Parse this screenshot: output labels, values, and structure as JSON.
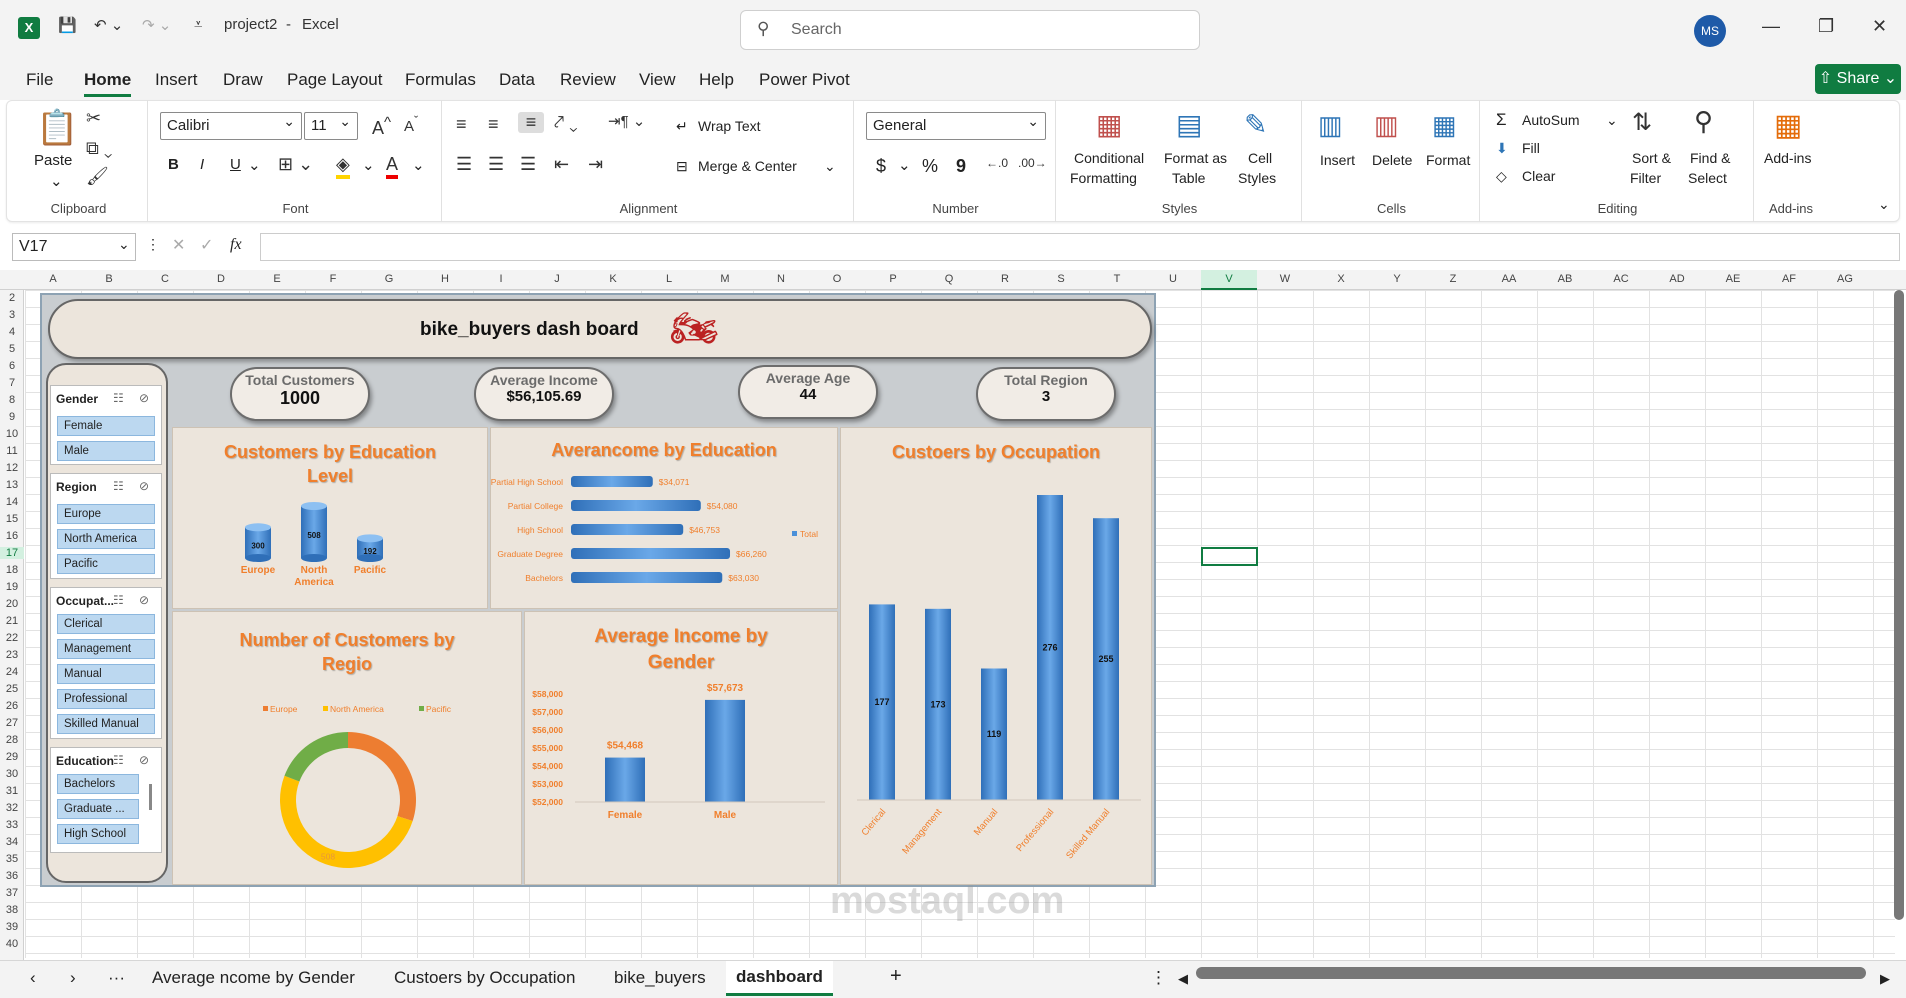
{
  "title_bar": {
    "filename": "project2",
    "app": "Excel",
    "search_placeholder": "Search",
    "user_initials": "MS"
  },
  "menu": [
    "File",
    "Home",
    "Insert",
    "Draw",
    "Page Layout",
    "Formulas",
    "Data",
    "Review",
    "View",
    "Help",
    "Power Pivot"
  ],
  "share_label": "Share",
  "ribbon": {
    "clipboard": {
      "paste": "Paste",
      "label": "Clipboard"
    },
    "font": {
      "name": "Calibri",
      "size": "11",
      "label": "Font",
      "bold": "B",
      "italic": "I",
      "underline": "U"
    },
    "alignment": {
      "wrap": "Wrap Text",
      "merge": "Merge & Center",
      "label": "Alignment"
    },
    "number": {
      "format": "General",
      "label": "Number",
      "currency": "$",
      "percent": "%",
      "comma": "9"
    },
    "styles": {
      "conditional": "Conditional",
      "formatting": "Formatting",
      "format_as": "Format as",
      "table": "Table",
      "cell": "Cell",
      "cell_styles": "Styles",
      "label": "Styles"
    },
    "cells": {
      "insert": "Insert",
      "delete": "Delete",
      "format": "Format",
      "label": "Cells"
    },
    "editing": {
      "autosum": "AutoSum",
      "fill": "Fill",
      "clear": "Clear",
      "sort": "Sort &",
      "filter": "Filter",
      "find": "Find &",
      "select": "Select",
      "label": "Editing"
    },
    "addins": {
      "name": "Add-ins",
      "label": "Add-ins"
    }
  },
  "formula_bar": {
    "cell_ref": "V17",
    "value": "",
    "fx": "fx"
  },
  "columns": [
    "A",
    "B",
    "C",
    "D",
    "E",
    "F",
    "G",
    "H",
    "I",
    "J",
    "K",
    "L",
    "M",
    "N",
    "O",
    "P",
    "Q",
    "R",
    "S",
    "T",
    "U",
    "V",
    "W",
    "X",
    "Y",
    "Z",
    "AA",
    "AB",
    "AC",
    "AD",
    "AE",
    "AF",
    "AG"
  ],
  "rows": [
    "2",
    "3",
    "4",
    "5",
    "6",
    "7",
    "8",
    "9",
    "10",
    "11",
    "12",
    "13",
    "14",
    "15",
    "16",
    "17",
    "18",
    "19",
    "20",
    "21",
    "22",
    "23",
    "24",
    "25",
    "26",
    "27",
    "28",
    "29",
    "30",
    "31",
    "32",
    "33",
    "34",
    "35",
    "36",
    "37",
    "38",
    "39",
    "40"
  ],
  "dashboard": {
    "title": "bike_buyers dash board",
    "kpis": [
      {
        "label": "Total Customers",
        "value": "1000"
      },
      {
        "label": "Average Income",
        "value": "$56,105.69"
      },
      {
        "label": "Average Age",
        "value": "44"
      },
      {
        "label": "Total Region",
        "value": "3"
      }
    ],
    "slicers": [
      {
        "header": "Gender",
        "items": [
          "Female",
          "Male"
        ]
      },
      {
        "header": "Region",
        "items": [
          "Europe",
          "North America",
          "Pacific"
        ]
      },
      {
        "header": "Occupat...",
        "items": [
          "Clerical",
          "Management",
          "Manual",
          "Professional",
          "Skilled Manual"
        ]
      },
      {
        "header": "Education",
        "items": [
          "Bachelors",
          "Graduate ...",
          "High School"
        ]
      }
    ]
  },
  "chart_data": [
    {
      "type": "bar",
      "title": "Customers by Education Level",
      "categories": [
        "Europe",
        "North America",
        "Pacific"
      ],
      "values": [
        300,
        508,
        192
      ]
    },
    {
      "type": "bar",
      "orientation": "horizontal",
      "title": "Averancome by Education",
      "categories": [
        "Partial High School",
        "Partial College",
        "High School",
        "Graduate Degree",
        "Bachelors"
      ],
      "values": [
        34071,
        54080,
        46753,
        66260,
        63030
      ],
      "labels": [
        "$34,071",
        "$54,080",
        "$46,753",
        "$66,260",
        "$63,030"
      ],
      "legend": [
        "Total"
      ]
    },
    {
      "type": "bar",
      "title": "Custoers by Occupation",
      "categories": [
        "Clerical",
        "Management",
        "Manual",
        "Professional",
        "Skilled Manual"
      ],
      "values": [
        177,
        173,
        119,
        276,
        255
      ]
    },
    {
      "type": "pie",
      "title": "Number of Customers by Regio",
      "categories": [
        "Europe",
        "North America",
        "Pacific"
      ],
      "values": [
        300,
        508,
        192
      ],
      "colors": [
        "#ed7d31",
        "#ffc000",
        "#70ad47"
      ],
      "slice_labels": [
        "",
        "508",
        ""
      ]
    },
    {
      "type": "bar",
      "title": "Average Income by Gender",
      "categories": [
        "Female",
        "Male"
      ],
      "values": [
        54468,
        57673
      ],
      "labels": [
        "$54,468",
        "$57,673"
      ],
      "ylim": [
        52000,
        58000
      ],
      "yticks": [
        "$52,000",
        "$53,000",
        "$54,000",
        "$55,000",
        "$56,000",
        "$57,000",
        "$58,000"
      ]
    }
  ],
  "sheet_tabs": [
    "Average ncome by Gender",
    "Custoers by Occupation",
    "bike_buyers",
    "dashboard"
  ],
  "active_tab": "dashboard",
  "colors": {
    "accent": "#107c41",
    "chart_orange": "#f07f2c",
    "bar_blue": "#4a90d9"
  }
}
